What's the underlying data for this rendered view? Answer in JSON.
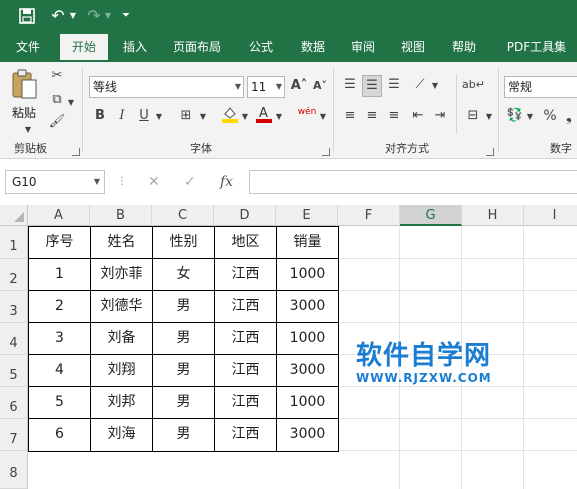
{
  "quick_access": {
    "save_icon": "save-icon",
    "undo_icon": "undo-icon",
    "redo_icon": "redo-icon",
    "customize_icon": "customize-icon"
  },
  "ribbon_tabs": [
    "文件",
    "开始",
    "插入",
    "页面布局",
    "公式",
    "数据",
    "审阅",
    "视图",
    "帮助",
    "PDF工具集"
  ],
  "active_tab": "开始",
  "clipboard": {
    "paste_label": "粘贴",
    "group_label": "剪贴板"
  },
  "font": {
    "name": "等线",
    "size": "11",
    "group_label": "字体",
    "bold": "B",
    "italic": "I",
    "underline": "U",
    "grow": "A˄",
    "shrink": "A˅",
    "phonetic": "wén"
  },
  "alignment": {
    "group_label": "对齐方式"
  },
  "number": {
    "format": "常规",
    "group_label": "数字",
    "percent": "%"
  },
  "name_box": "G10",
  "formula_bar": {
    "cancel": "✕",
    "enter": "✓",
    "fx": "fx",
    "value": ""
  },
  "columns": [
    "A",
    "B",
    "C",
    "D",
    "E",
    "F",
    "G",
    "H",
    "I"
  ],
  "selected_column": "G",
  "rows": [
    "1",
    "2",
    "3",
    "4",
    "5",
    "6",
    "7",
    "8"
  ],
  "table": {
    "headers": [
      "序号",
      "姓名",
      "性别",
      "地区",
      "销量"
    ],
    "rows": [
      [
        "1",
        "刘亦菲",
        "女",
        "江西",
        "1000"
      ],
      [
        "2",
        "刘德华",
        "男",
        "江西",
        "3000"
      ],
      [
        "3",
        "刘备",
        "男",
        "江西",
        "1000"
      ],
      [
        "4",
        "刘翔",
        "男",
        "江西",
        "3000"
      ],
      [
        "5",
        "刘邦",
        "男",
        "江西",
        "1000"
      ],
      [
        "6",
        "刘海",
        "男",
        "江西",
        "3000"
      ]
    ]
  },
  "watermark": {
    "title": "软件自学网",
    "url": "WWW.RJZXW.COM"
  },
  "colors": {
    "excel_green": "#217346",
    "watermark_blue": "#1a7dd1",
    "font_color_red": "#d00000",
    "fill_yellow": "#ffd800"
  }
}
